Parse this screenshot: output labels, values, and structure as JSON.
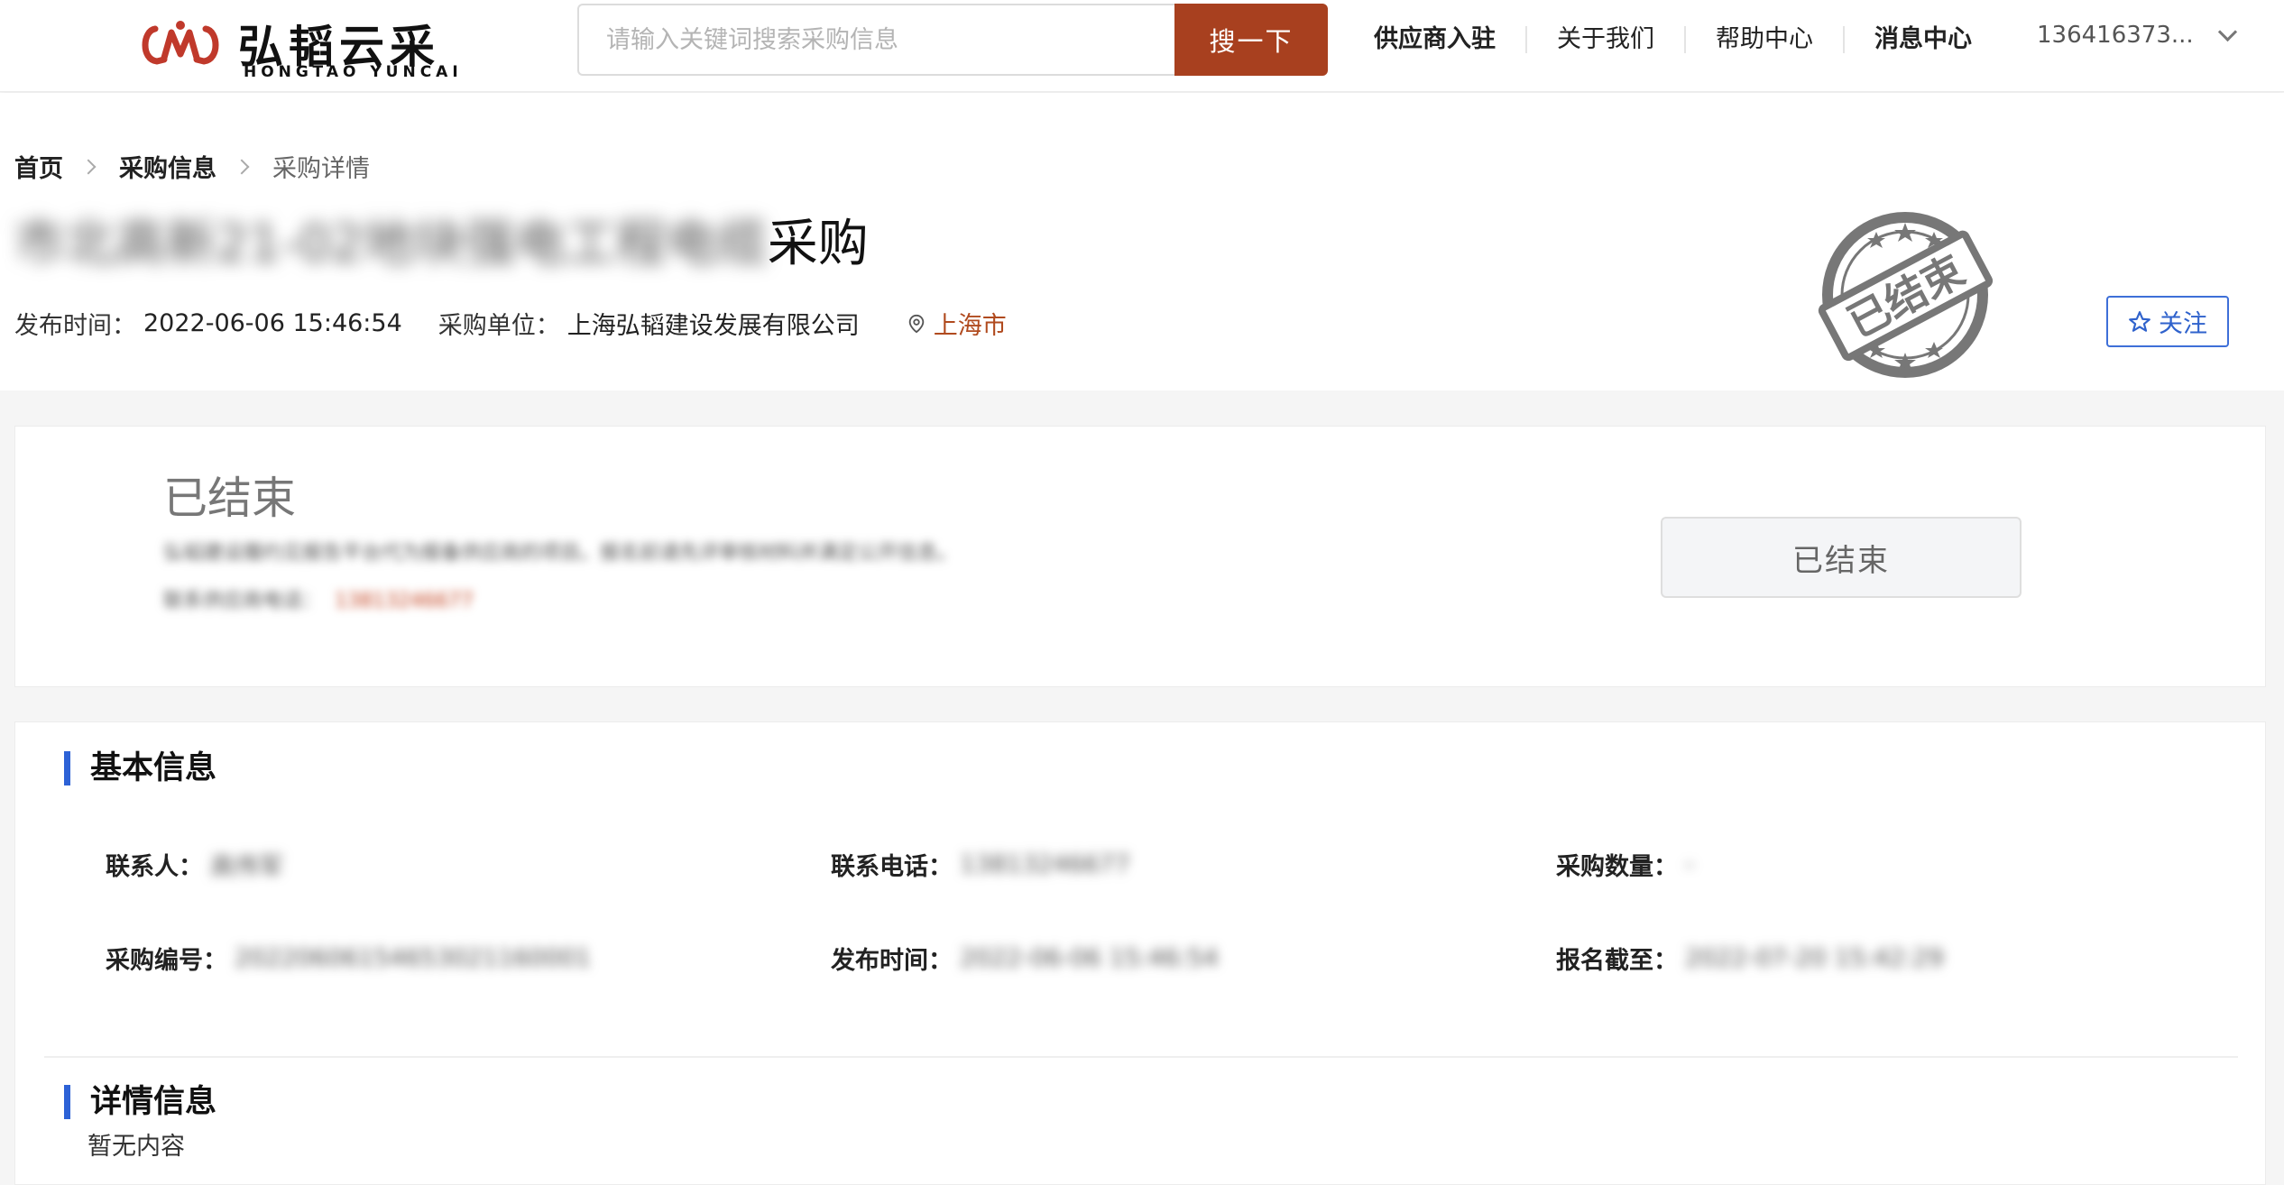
{
  "header": {
    "logo_cn": "弘韬云采",
    "logo_en": "HONGTAO YUNCAI",
    "search_placeholder": "请输入关键词搜索采购信息",
    "search_button": "搜一下",
    "nav": [
      "供应商入驻",
      "关于我们",
      "帮助中心",
      "消息中心"
    ],
    "account": "136416373..."
  },
  "breadcrumb": [
    "首页",
    "采购信息",
    "采购详情"
  ],
  "title": {
    "blurred_part": "市北高新21-02地块强电工程电缆",
    "suffix": "采购"
  },
  "meta": {
    "publish_label": "发布时间：",
    "publish_value": "2022-06-06 15:46:54",
    "buyer_label": "采购单位：",
    "buyer_value": "上海弘韬建设发展有限公司",
    "location": "上海市"
  },
  "stamp_text": "已结束",
  "follow_label": "关注",
  "status": {
    "heading": "已结束",
    "line1": "弘韬建设履约见报告平台代为报备供应商的项目。报名前请先评审核材料并满足公开信息。",
    "line2_label": "联系供应商电话：",
    "line2_phone": "13813246677",
    "button": "已结束"
  },
  "basic_info": {
    "title": "基本信息",
    "fields": [
      {
        "label": "联系人：",
        "value": "高伟军"
      },
      {
        "label": "联系电话：",
        "value": "13813246677"
      },
      {
        "label": "采购数量：",
        "value": "-"
      },
      {
        "label": "采购编号：",
        "value": "20220606154653021160001"
      },
      {
        "label": "发布时间：",
        "value": "2022-06-06 15:46:54"
      },
      {
        "label": "报名截至：",
        "value": "2022-07-20 15:42:29"
      }
    ]
  },
  "detail_info": {
    "title": "详情信息",
    "empty": "暂无内容"
  },
  "colors": {
    "brand": "#a8401f",
    "accent_blue": "#2d62d6",
    "location": "#b04a1e"
  }
}
